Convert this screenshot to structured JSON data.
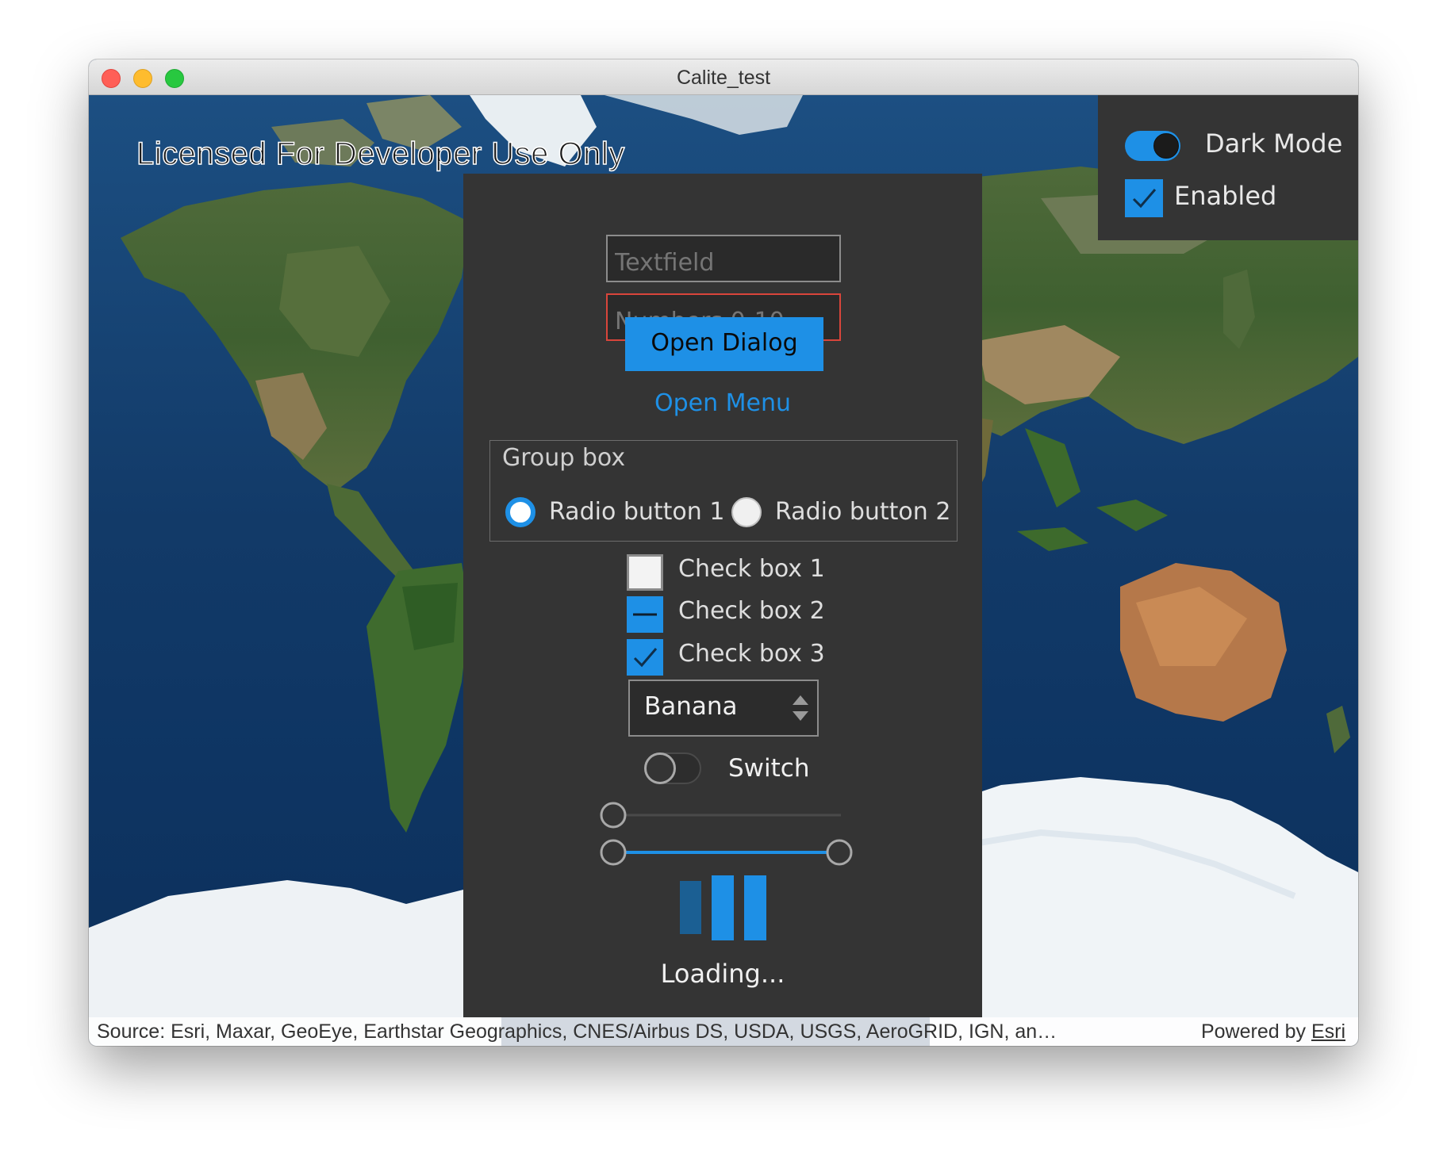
{
  "window": {
    "title": "Calite_test"
  },
  "map": {
    "watermark": "Licensed For Developer Use Only",
    "attribution_source": "Source: Esri, Maxar, GeoEye, Earthstar Geographics, CNES/Airbus DS, USDA, USGS, AeroGRID, IGN, an…",
    "attribution_powered_prefix": "Powered by ",
    "attribution_powered_link": "Esri"
  },
  "mode_panel": {
    "dark_mode_label": "Dark Mode",
    "dark_mode_on": true,
    "enabled_label": "Enabled",
    "enabled_checked": true
  },
  "controls": {
    "textfield_placeholder": "Textfield",
    "numbers_placeholder": "Numbers 0-10",
    "open_dialog_label": "Open Dialog",
    "open_menu_label": "Open Menu",
    "group_box": {
      "title": "Group box",
      "radios": [
        {
          "label": "Radio button 1",
          "checked": true
        },
        {
          "label": "Radio button 2",
          "checked": false
        }
      ]
    },
    "checkboxes": [
      {
        "label": "Check box 1",
        "state": "unchecked"
      },
      {
        "label": "Check box 2",
        "state": "partial"
      },
      {
        "label": "Check box 3",
        "state": "checked"
      }
    ],
    "combo_value": "Banana",
    "switch_label": "Switch",
    "switch_on": false,
    "slider_value": 0,
    "range_slider_values": [
      0,
      1
    ],
    "loading_label": "Loading..."
  },
  "colors": {
    "accent": "#1e90e6",
    "panel_bg": "#343434",
    "error_border": "#d9453b"
  }
}
